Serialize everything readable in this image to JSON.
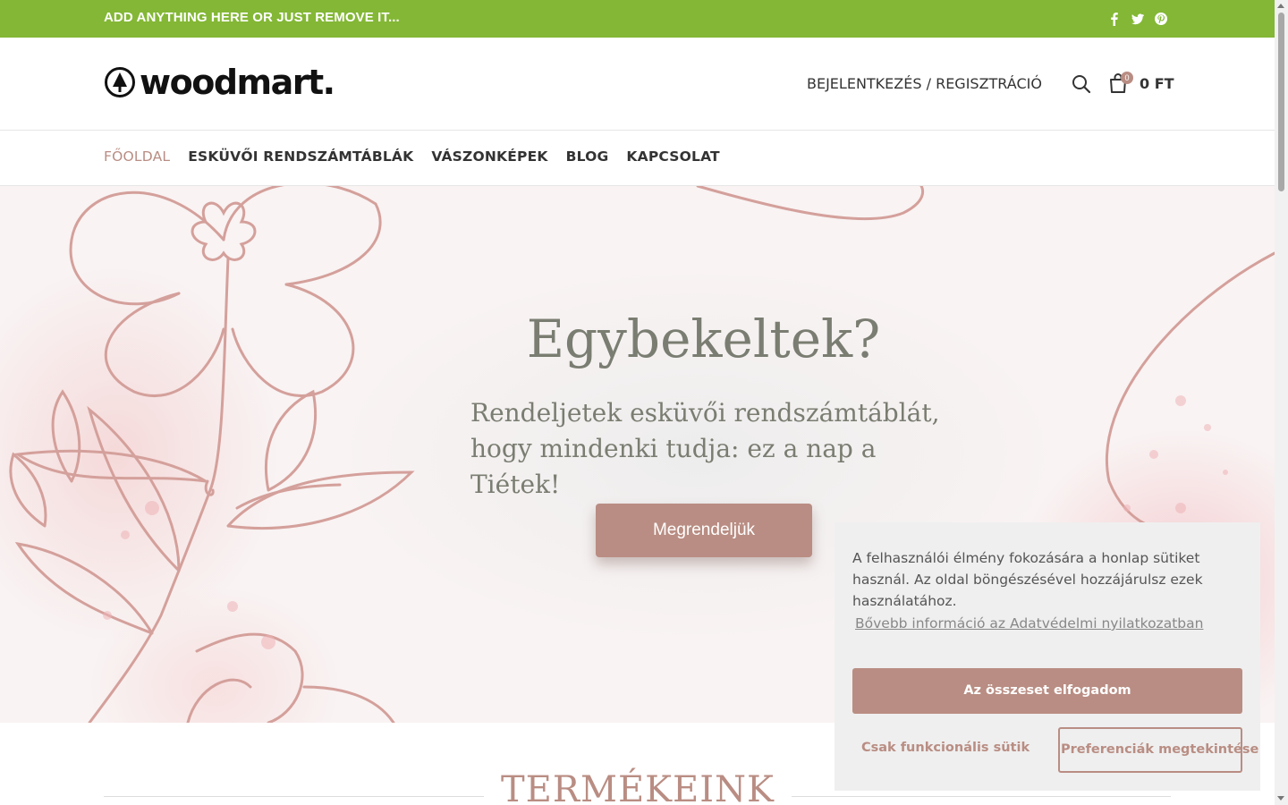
{
  "colors": {
    "topbar": "#83b735",
    "accent": "#b98d83",
    "hero_text": "#7a7d71"
  },
  "topbar": {
    "text": "ADD ANYTHING HERE OR JUST REMOVE IT...",
    "social_icons": [
      "facebook-icon",
      "twitter-icon",
      "pinterest-icon"
    ]
  },
  "header": {
    "logo_text": "woodmart.",
    "login_label": "BEJELENTKEZÉS / REGISZTRÁCIÓ",
    "cart_count": "0",
    "cart_total": "0 FT"
  },
  "nav": {
    "items": [
      {
        "label": "FŐOLDAL",
        "active": true
      },
      {
        "label": "ESKÜVŐI RENDSZÁMTÁBLÁK"
      },
      {
        "label": "VÁSZONKÉPEK"
      },
      {
        "label": "BLOG"
      },
      {
        "label": "KAPCSOLAT"
      }
    ]
  },
  "hero": {
    "title": "Egybekeltek?",
    "subtitle_line1": "Rendeljetek esküvői rendszámtáblát,",
    "subtitle_line2": "hogy mindenki tudja: ez a nap a Tiétek!",
    "button_label": "Megrendeljük"
  },
  "products": {
    "title": "TERMÉKEINK"
  },
  "cookie": {
    "text": "A felhasználói élmény fokozására a honlap sütiket használ. Az oldal böngészésével hozzájárulsz ezek használatához.",
    "link_label": "Bővebb információ az Adatvédelmi nyilatkozatban",
    "accept_label": "Az összeset elfogadom",
    "functional_label": "Csak funkcionális sütik",
    "preferences_label": "Preferenciák megtekintése"
  }
}
